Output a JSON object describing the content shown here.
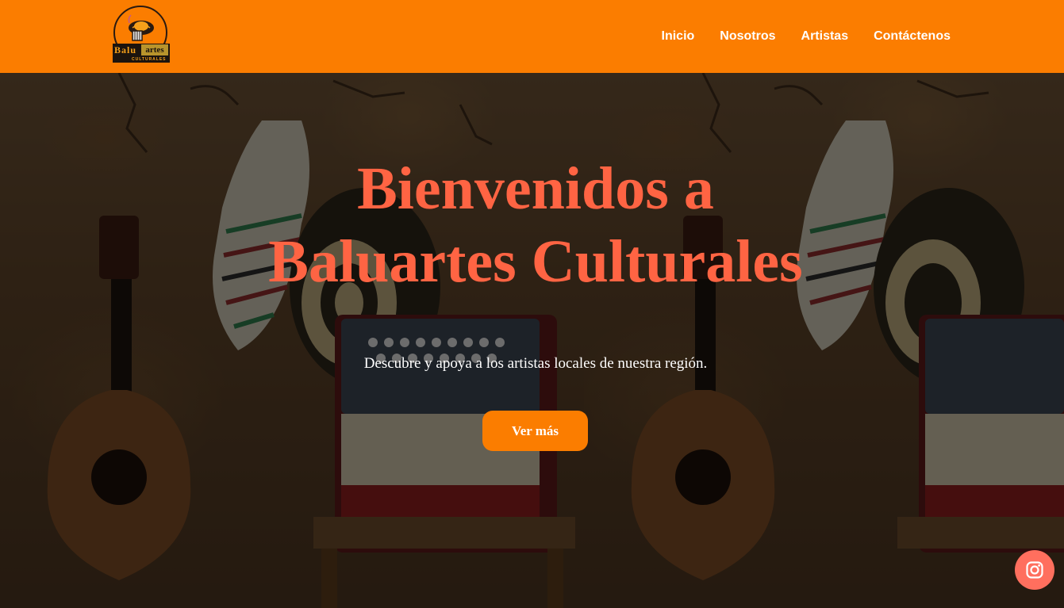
{
  "brand": {
    "logo_word1": "Balu",
    "logo_word2": "artes",
    "logo_word3": "CULTURALES"
  },
  "nav": {
    "items": [
      {
        "label": "Inicio"
      },
      {
        "label": "Nosotros"
      },
      {
        "label": "Artistas"
      },
      {
        "label": "Contáctenos"
      }
    ]
  },
  "hero": {
    "title_line1": "Bienvenidos a",
    "title_line2": "Baluartes Culturales",
    "subtitle": "Descubre y apoya a los artistas locales de nuestra región.",
    "cta_label": "Ver más"
  },
  "social": {
    "instagram_icon": "instagram-icon"
  },
  "colors": {
    "navbar": "#fb7d00",
    "title": "#ff6443",
    "button": "#fb7d00",
    "instagram_button": "#ff6f5e"
  }
}
